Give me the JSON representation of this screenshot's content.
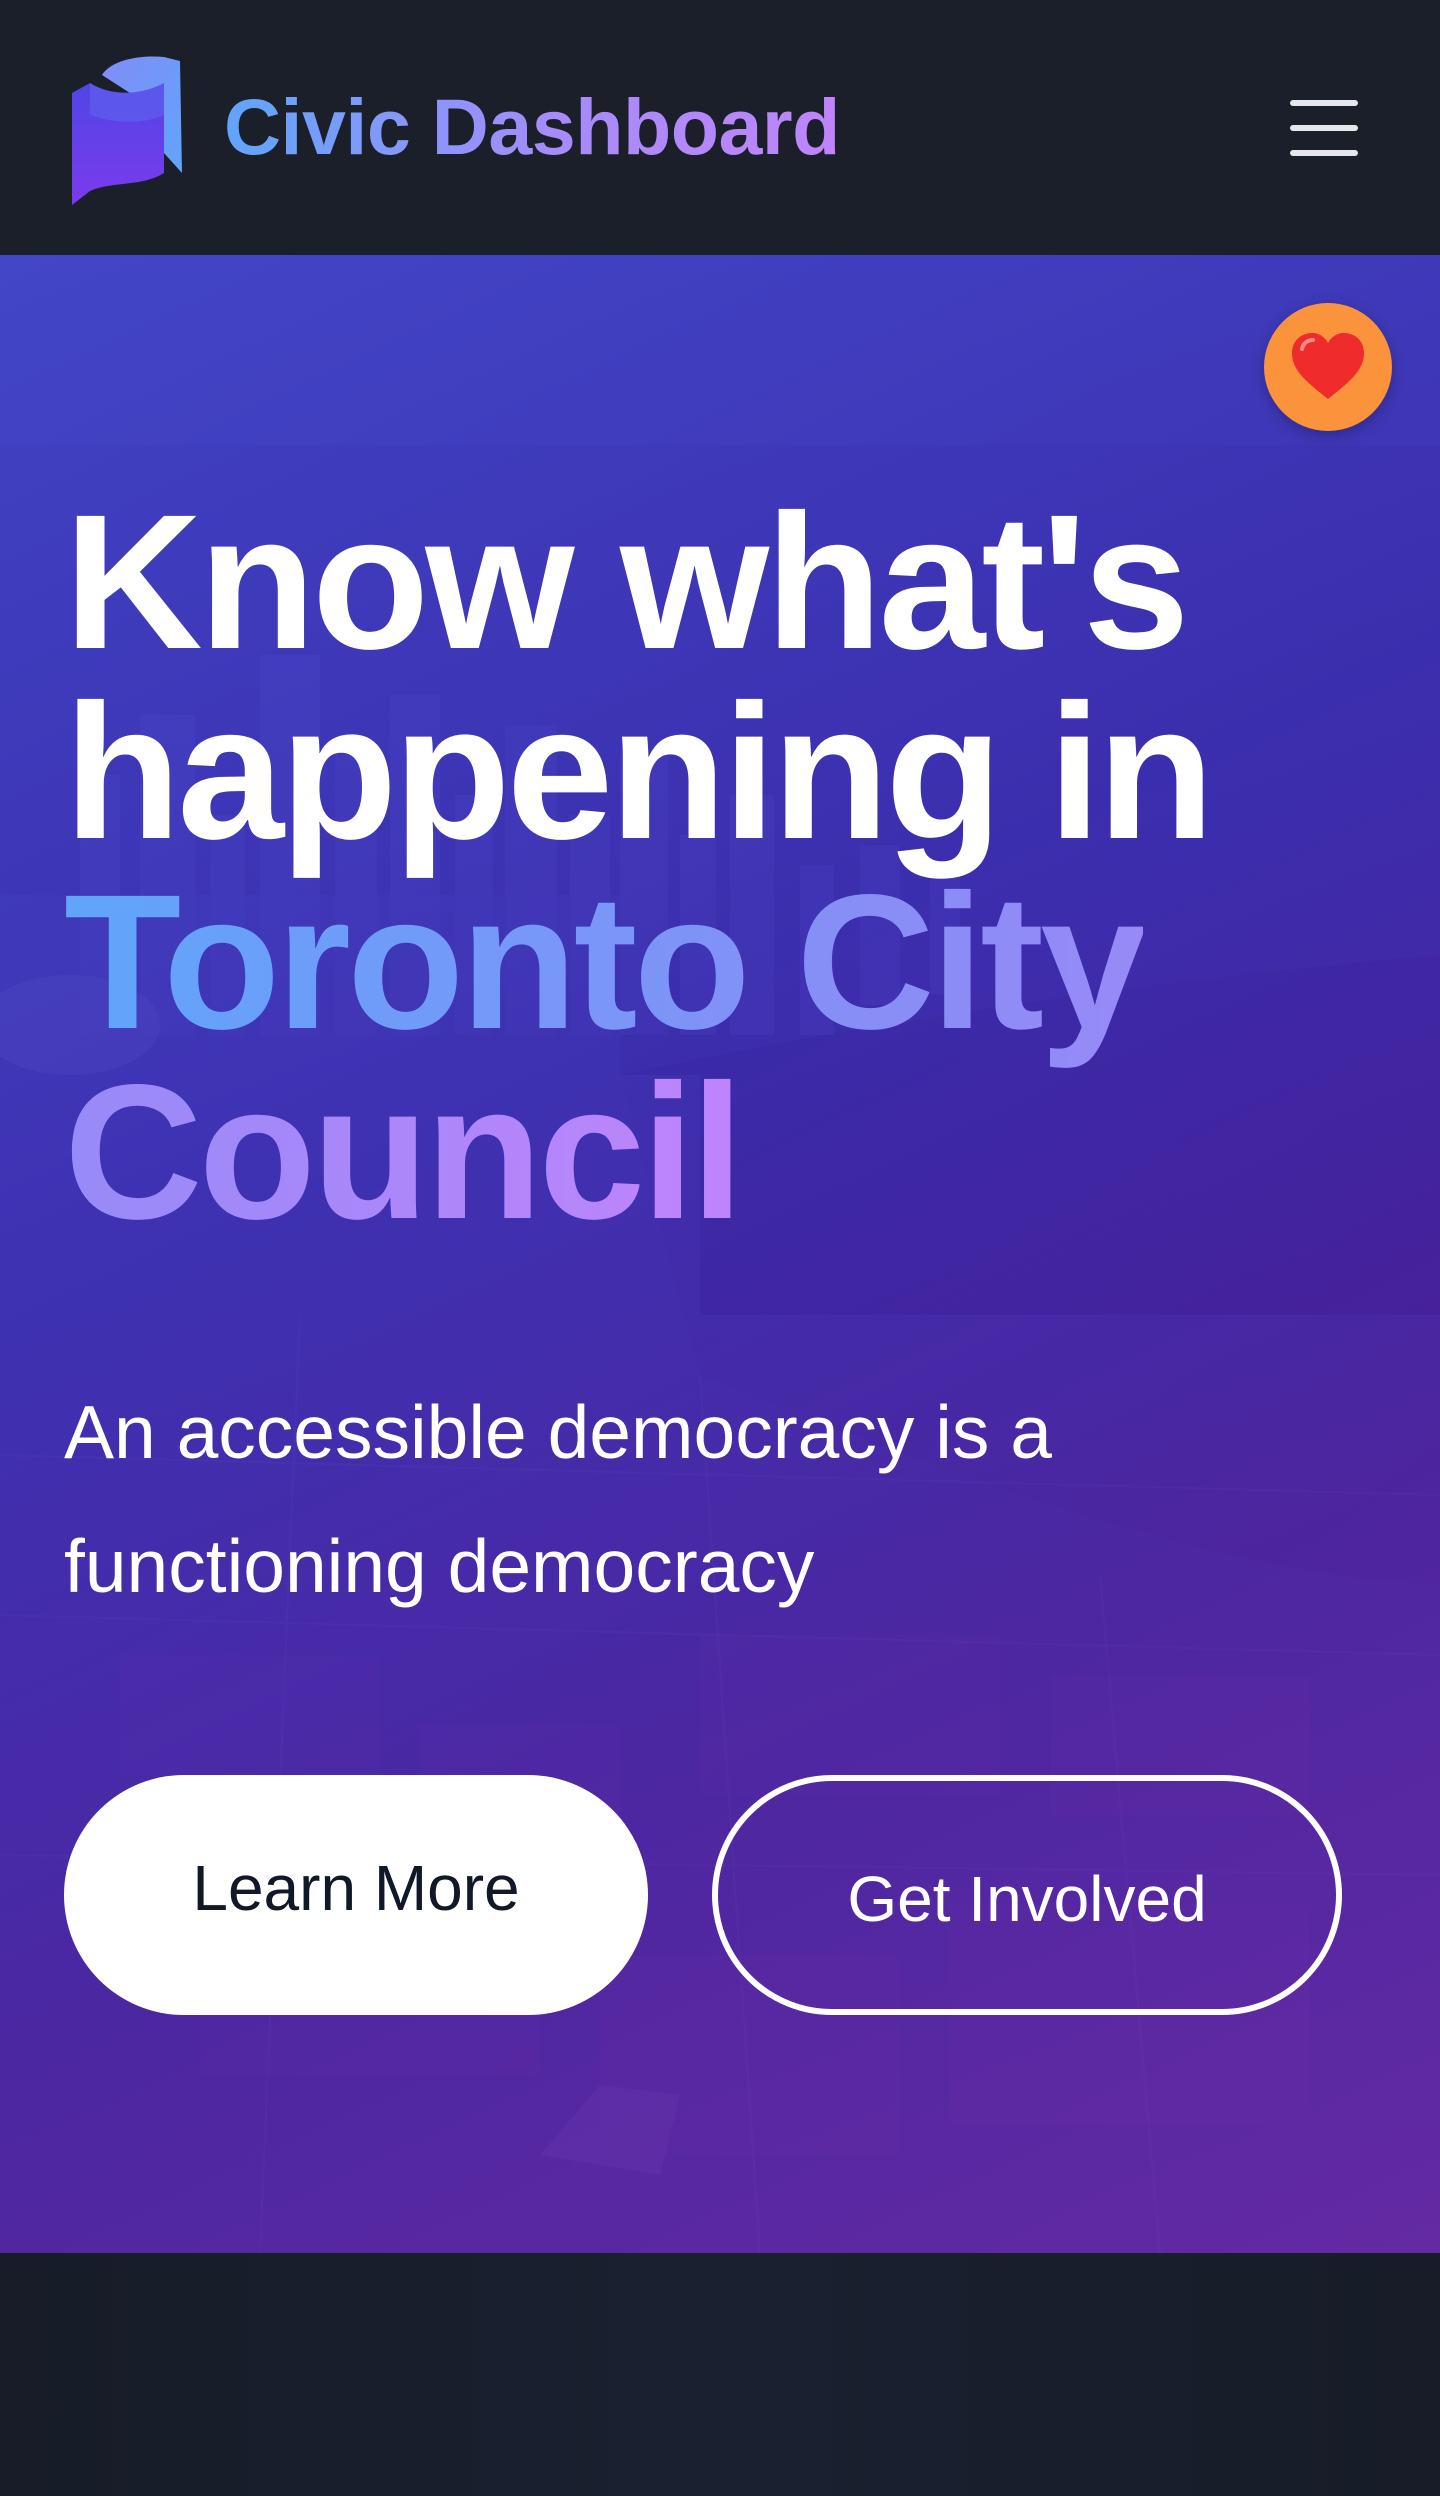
{
  "header": {
    "brand_name": "Civic Dashboard",
    "logo_icon": "rolled-flag-logo",
    "menu_icon": "hamburger-menu-icon"
  },
  "hero": {
    "favorite_icon": "red-heart-icon",
    "headline_line1": "Know what's",
    "headline_line2": "happening in",
    "headline_highlight": "Toronto City Council",
    "tagline": "An accessible democracy is a functioning democracy",
    "primary_button_label": "Learn More",
    "secondary_button_label": "Get Involved",
    "background_image": "aerial-toronto-skyline-photo"
  },
  "colors": {
    "header_bg": "#1b1f2a",
    "brand_gradient_start": "#60a5fa",
    "brand_gradient_end": "#c084fc",
    "hero_overlay": "#4338ca",
    "favorite_button_bg": "#fb923c",
    "primary_button_bg": "#ffffff",
    "primary_button_text": "#111827",
    "secondary_button_border": "#ffffff",
    "page_bg": "#181d29"
  }
}
